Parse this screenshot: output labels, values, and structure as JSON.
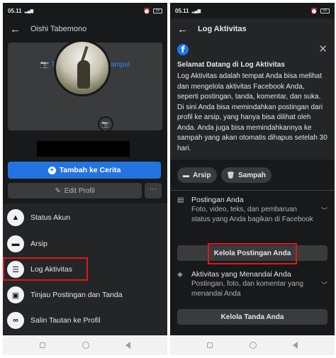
{
  "status_bar": {
    "time": "05.11",
    "signal": "4G",
    "battery": "55"
  },
  "left_screen": {
    "header": {
      "back_icon": "arrow-left-icon",
      "title": "Oishi Tabemono"
    },
    "cover": {
      "label": "Tambahkan Foto Sampul"
    },
    "buttons": {
      "story": "Tambah ke Cerita",
      "edit_profile": "Edit Profil",
      "more": "···"
    },
    "menu": [
      {
        "label": "Status Akun",
        "icon": "alert-icon"
      },
      {
        "label": "Arsip",
        "icon": "archive-icon"
      },
      {
        "label": "Log Aktivitas",
        "icon": "list-icon"
      },
      {
        "label": "Tinjau Postingan dan Tanda",
        "icon": "review-icon"
      },
      {
        "label": "Salin Tautan ke Profil",
        "icon": "link-icon"
      }
    ],
    "highlighted_item": "Log Aktivitas"
  },
  "right_screen": {
    "header": {
      "back_icon": "arrow-left-icon",
      "title": "Log Aktivitas"
    },
    "welcome": {
      "title": "Selamat Datang di Log Aktivitas",
      "body": "Log Aktivitas adalah tempat Anda bisa melihat dan mengelola aktivitas Facebook Anda, seperti postingan, tanda, komentar, dan suka. Di sini Anda bisa memindahkan postingan dari profil ke arsip, yang hanya bisa dilihat oleh Anda. Anda juga bisa memindahkannya ke sampah yang akan otomatis dihapus setelah 30 hari."
    },
    "chips": [
      {
        "label": "Arsip",
        "icon": "archive-icon"
      },
      {
        "label": "Sampah",
        "icon": "trash-icon"
      }
    ],
    "sections": [
      {
        "title": "Postingan Anda",
        "desc": "Foto, video, teks, dan pembaruan status yang Anda bagikan di Facebook",
        "button": "Kelola Postingan Anda"
      },
      {
        "title": "Aktivitas yang Menandai Anda",
        "desc": "Postingan, foto, dan komentar yang menandai Anda",
        "button": "Kelola Tanda Anda"
      }
    ],
    "highlighted_button": "Kelola Postingan Anda"
  },
  "colors": {
    "background": "#18191a",
    "surface": "#242526",
    "button": "#3a3b3c",
    "accent": "#2374e1",
    "highlight": "#e0161b"
  }
}
